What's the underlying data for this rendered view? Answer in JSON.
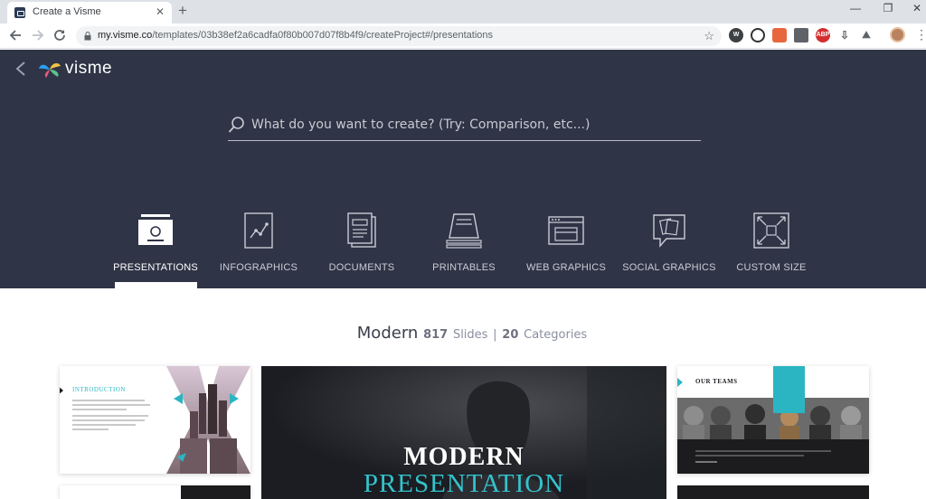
{
  "browser": {
    "tab_title": "Create a Visme",
    "tab_close": "✕",
    "new_tab": "+",
    "url_host": "my.visme.co",
    "url_path": "/templates/03b38ef2a6cadfa0f80b007d07f8b4f9/createProject#/presentations",
    "window": {
      "minimize": "—",
      "restore": "❐",
      "close": "✕"
    }
  },
  "header": {
    "logo_text": "visme",
    "search_placeholder": "What do you want to create? (Try: Comparison, etc...)"
  },
  "categories": [
    {
      "label": "PRESENTATIONS",
      "icon": "presentation-icon",
      "active": true
    },
    {
      "label": "INFOGRAPHICS",
      "icon": "infographic-icon",
      "active": false
    },
    {
      "label": "DOCUMENTS",
      "icon": "documents-icon",
      "active": false
    },
    {
      "label": "PRINTABLES",
      "icon": "printables-icon",
      "active": false
    },
    {
      "label": "WEB GRAPHICS",
      "icon": "web-graphics-icon",
      "active": false
    },
    {
      "label": "SOCIAL GRAPHICS",
      "icon": "social-graphics-icon",
      "active": false
    },
    {
      "label": "CUSTOM SIZE",
      "icon": "custom-size-icon",
      "active": false
    }
  ],
  "section": {
    "title": "Modern",
    "slides_count": "817",
    "slides_label": "Slides",
    "separator": "|",
    "categories_count": "20",
    "categories_label": "Categories"
  },
  "templates": {
    "left_title": "INTRODUCTION",
    "center_title": "MODERN",
    "center_subtitle": "PRESENTATION",
    "right_title": "OUR TEAMS"
  },
  "colors": {
    "header_bg": "#2f3446",
    "accent": "#2bb5c2",
    "logo_blue": "#2a9df4",
    "logo_yellow": "#f6c343",
    "logo_green": "#5cc18e"
  }
}
